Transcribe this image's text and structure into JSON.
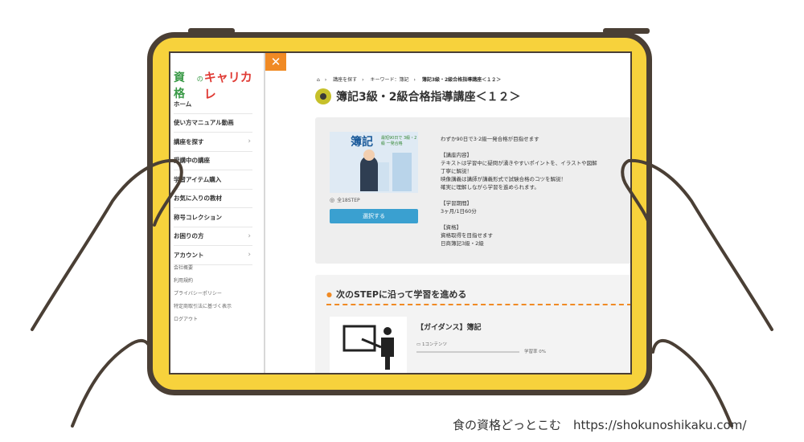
{
  "sidebar": {
    "logo": {
      "part1": "資格",
      "part2": "の",
      "part3": "キャリカレ"
    },
    "items": [
      {
        "label": "ホーム",
        "has_chevron": false
      },
      {
        "label": "使い方マニュアル動画",
        "has_chevron": false
      },
      {
        "label": "講座を探す",
        "has_chevron": true
      },
      {
        "label": "受講中の講座",
        "has_chevron": false
      },
      {
        "label": "学習アイテム購入",
        "has_chevron": false
      },
      {
        "label": "お気に入りの教材",
        "has_chevron": false
      },
      {
        "label": "称号コレクション",
        "has_chevron": false
      },
      {
        "label": "お困りの方",
        "has_chevron": true
      },
      {
        "label": "アカウント",
        "has_chevron": true
      }
    ],
    "links": [
      "会社概要",
      "利用規約",
      "プライバシーポリシー",
      "特定商取引法に基づく表示",
      "ログアウト"
    ],
    "chevron": "›"
  },
  "close_button": {
    "label": "✕"
  },
  "breadcrumb": {
    "home_icon": "house-icon",
    "separator": "›",
    "items": [
      "講座を探す",
      "キーワード：簿記",
      "簿記3級・2級合格指導講座＜１２＞"
    ]
  },
  "page_title": "簿記3級・2級合格指導講座＜１２＞",
  "course": {
    "thumb_title": "簿記",
    "thumb_sub": "最短90日で 3級・2級 一発合格",
    "steps": "全18STEP",
    "select_label": "選択する",
    "description": [
      "わずか90日で3·2級一発合格が目指せます",
      "",
      "【講座内容】",
      "テキストは学習中に疑問が湧きやすいポイントを、イラストや図解",
      "丁寧に解説！",
      "映像講義は講師が講義形式で試験合格のコツを解説！",
      "確実に理解しながら学習を進められます。",
      "",
      "【学習期間】",
      "3ヶ月/1日60分",
      "",
      "【資格】",
      "資格取得を目指せます",
      "日商簿記3級・2級"
    ]
  },
  "steps_section": {
    "heading": "次のSTEPに沿って学習を進める",
    "lesson_title": "【ガイダンス】簿記",
    "lesson_meta": "1コンテンツ",
    "progress_label": "学習率 0%",
    "progress": 0
  },
  "credit": "食の資格どっとこむ　https://shokunoshikaku.com/",
  "colors": {
    "frame": "#f7d23c",
    "outline": "#4a3f35",
    "accent": "#f08a24",
    "button": "#3aa0d0",
    "logo_green": "#3a9a47",
    "logo_red": "#e03b35"
  }
}
